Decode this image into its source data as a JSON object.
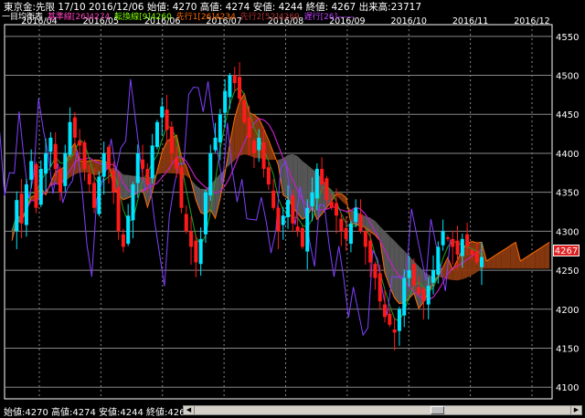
{
  "header": {
    "title_text": "東京金:先限  17/10  2016/12/06  始値: 4270  高値: 4274  安値: 4244  終値: 4267  出来高:23717"
  },
  "legend": {
    "prefix": "一目均衡表",
    "items": [
      {
        "label": "基準線[26]4274",
        "color": "#ff3fbf"
      },
      {
        "label": "転換線[9]4260",
        "color": "#7fff00"
      },
      {
        "label": "先行1[26]4234",
        "color": "#ff6a00"
      },
      {
        "label": "先行2[52]4269",
        "color": "#b03030"
      },
      {
        "label": "遅行[26]――",
        "color": "#c040ff"
      }
    ]
  },
  "price_label": "4267",
  "status_bar": {
    "text": "始値:4270  高値:4274  安値:4244  終値:4267"
  },
  "colors": {
    "up_candle": "#00e5ff",
    "down_candle": "#ff1a1a",
    "kumo_bull": "#8b3a0f",
    "kumo_bear": "#5a5a5a",
    "kijun": "#c020c0",
    "tenkan": "#20a020",
    "senkou1": "#ff6a00",
    "chikou": "#8040ff"
  },
  "chart_data": {
    "type": "candlestick",
    "title": "東京金:先限 17/10",
    "x_tick_labels": [
      "2016/04",
      "2016/05",
      "2016/06",
      "2016/07",
      "2016/08",
      "2016/09",
      "2016/10",
      "2016/11",
      "2016/12"
    ],
    "y_ticks": [
      4550,
      4500,
      4450,
      4400,
      4350,
      4300,
      4250,
      4200,
      4150,
      4100
    ],
    "ylim": [
      4085,
      4565
    ],
    "grid": true,
    "last": {
      "open": 4270,
      "high": 4274,
      "low": 4244,
      "close": 4267,
      "volume": 23717
    },
    "indicators": {
      "kijun_26": 4274,
      "tenkan_9": 4260,
      "senkou1_26": 4234,
      "senkou2_52": 4269
    },
    "close_series": [
      4300,
      4340,
      4310,
      4360,
      4390,
      4330,
      4380,
      4400,
      4420,
      4380,
      4350,
      4400,
      4440,
      4420,
      4410,
      4380,
      4360,
      4330,
      4370,
      4400,
      4380,
      4350,
      4300,
      4280,
      4320,
      4360,
      4400,
      4380,
      4360,
      4410,
      4440,
      4460,
      4430,
      4400,
      4380,
      4330,
      4300,
      4280,
      4260,
      4290,
      4350,
      4400,
      4420,
      4450,
      4480,
      4500,
      4490,
      4470,
      4440,
      4420,
      4400,
      4420,
      4380,
      4360,
      4330,
      4300,
      4320,
      4340,
      4310,
      4300,
      4280,
      4330,
      4350,
      4380,
      4360,
      4340,
      4330,
      4320,
      4300,
      4290,
      4310,
      4330,
      4300,
      4280,
      4260,
      4240,
      4210,
      4190,
      4180,
      4170,
      4200,
      4240,
      4250,
      4230,
      4220,
      4210,
      4230,
      4250,
      4280,
      4300,
      4290,
      4280,
      4270,
      4290,
      4280,
      4270,
      4260,
      4267
    ]
  }
}
